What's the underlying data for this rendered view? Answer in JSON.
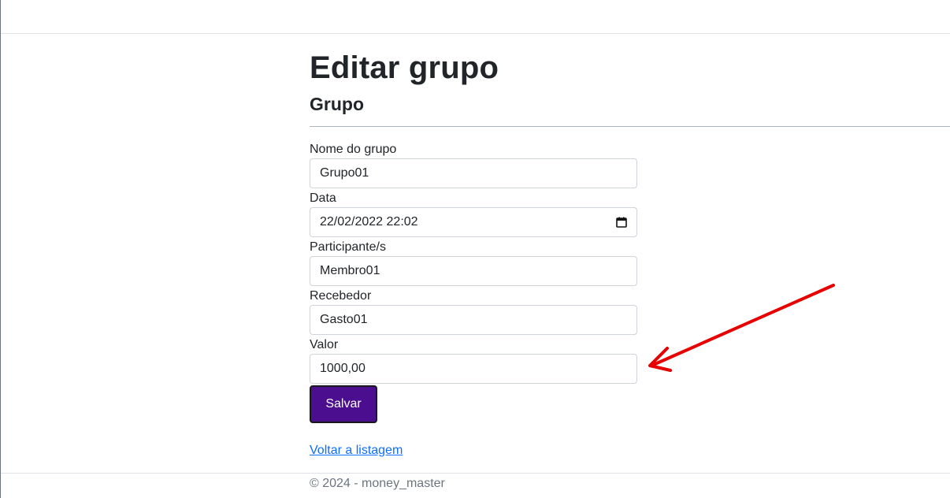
{
  "header": {
    "title": "Editar grupo",
    "subtitle": "Grupo"
  },
  "form": {
    "fields": [
      {
        "label": "Nome do grupo",
        "value": "Grupo01"
      },
      {
        "label": "Data",
        "value": "22/02/2022 22:02",
        "icon": "calendar-icon"
      },
      {
        "label": "Participante/s",
        "value": "Membro01"
      },
      {
        "label": "Recebedor",
        "value": "Gasto01"
      },
      {
        "label": "Valor",
        "value": "1000,00"
      }
    ],
    "save_label": "Salvar"
  },
  "links": {
    "back_label": "Voltar a listagem"
  },
  "footer": {
    "text": "© 2024 - money_master"
  },
  "colors": {
    "primary_button": "#4b0e8e",
    "link": "#0d6efd",
    "annotation_arrow": "#e60000"
  }
}
